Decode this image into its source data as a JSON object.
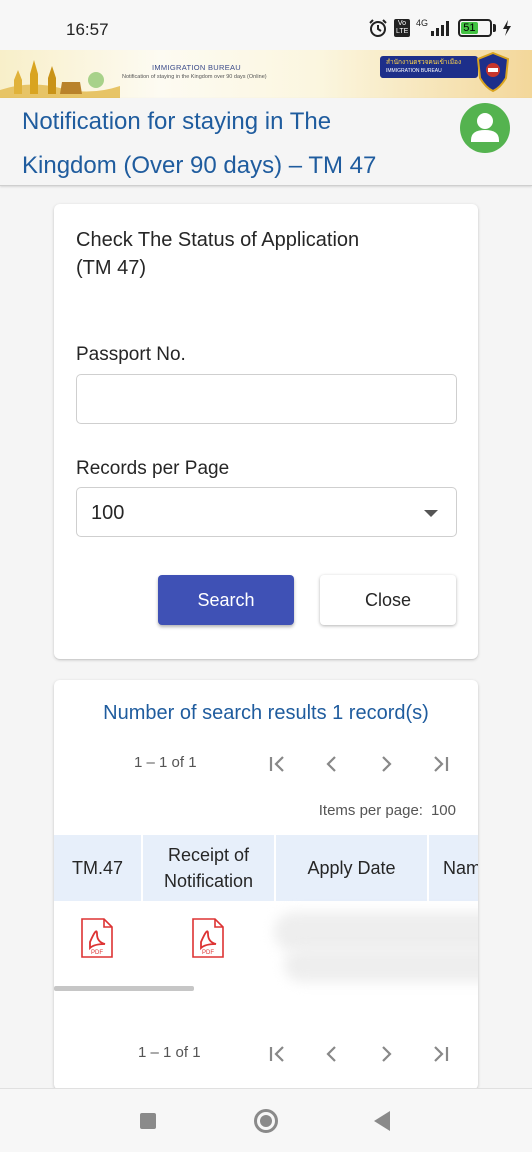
{
  "status_bar": {
    "time": "16:57",
    "network": "4G",
    "volte": "Vo LTE",
    "battery": "51"
  },
  "banner": {
    "bureau": "IMMIGRATION BUREAU",
    "bureau_sub": "Notification of staying in the Kingdom over 90 days (Online)",
    "thai_name": "สำนักงานตรวจคนเข้าเมือง",
    "thai_sub": "IMMIGRATION BUREAU"
  },
  "header": {
    "title_line1": "Notification for staying in The",
    "title_line2": "Kingdom (Over 90 days) – TM 47"
  },
  "form": {
    "title": "Check The Status of Application (TM 47)",
    "passport_label": "Passport No.",
    "passport_value": "",
    "records_label": "Records per Page",
    "records_value": "100",
    "search_button": "Search",
    "close_button": "Close"
  },
  "results": {
    "title": "Number of search results 1 record(s)",
    "range_top": "1 – 1 of 1",
    "range_bottom": "1 – 1 of 1",
    "items_per_page_label": "Items per page:",
    "items_per_page_value": "100",
    "columns": [
      "TM.47",
      "Receipt of Notification",
      "Apply Date",
      "Nam"
    ],
    "pdf_label": "PDF"
  },
  "icons": {
    "first_page": "first-page-icon",
    "prev_page": "chevron-left-icon",
    "next_page": "chevron-right-icon",
    "last_page": "last-page-icon"
  },
  "colors": {
    "accent": "#3f51b5",
    "title_blue": "#1f5c9e",
    "avatar_green": "#54b34f",
    "table_header": "#e7effa"
  }
}
